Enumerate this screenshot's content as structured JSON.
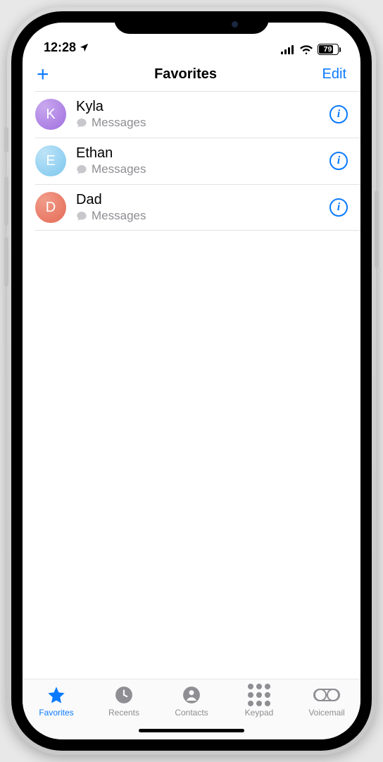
{
  "status": {
    "time": "12:28",
    "battery_pct": 79,
    "battery_label": "79"
  },
  "nav": {
    "title": "Favorites",
    "edit_label": "Edit"
  },
  "favorites": [
    {
      "initial": "K",
      "name": "Kyla",
      "subtitle": "Messages",
      "avatar": "av-purple"
    },
    {
      "initial": "E",
      "name": "Ethan",
      "subtitle": "Messages",
      "avatar": "av-blue"
    },
    {
      "initial": "D",
      "name": "Dad",
      "subtitle": "Messages",
      "avatar": "av-red"
    }
  ],
  "tabs": {
    "favorites": "Favorites",
    "recents": "Recents",
    "contacts": "Contacts",
    "keypad": "Keypad",
    "voicemail": "Voicemail"
  }
}
